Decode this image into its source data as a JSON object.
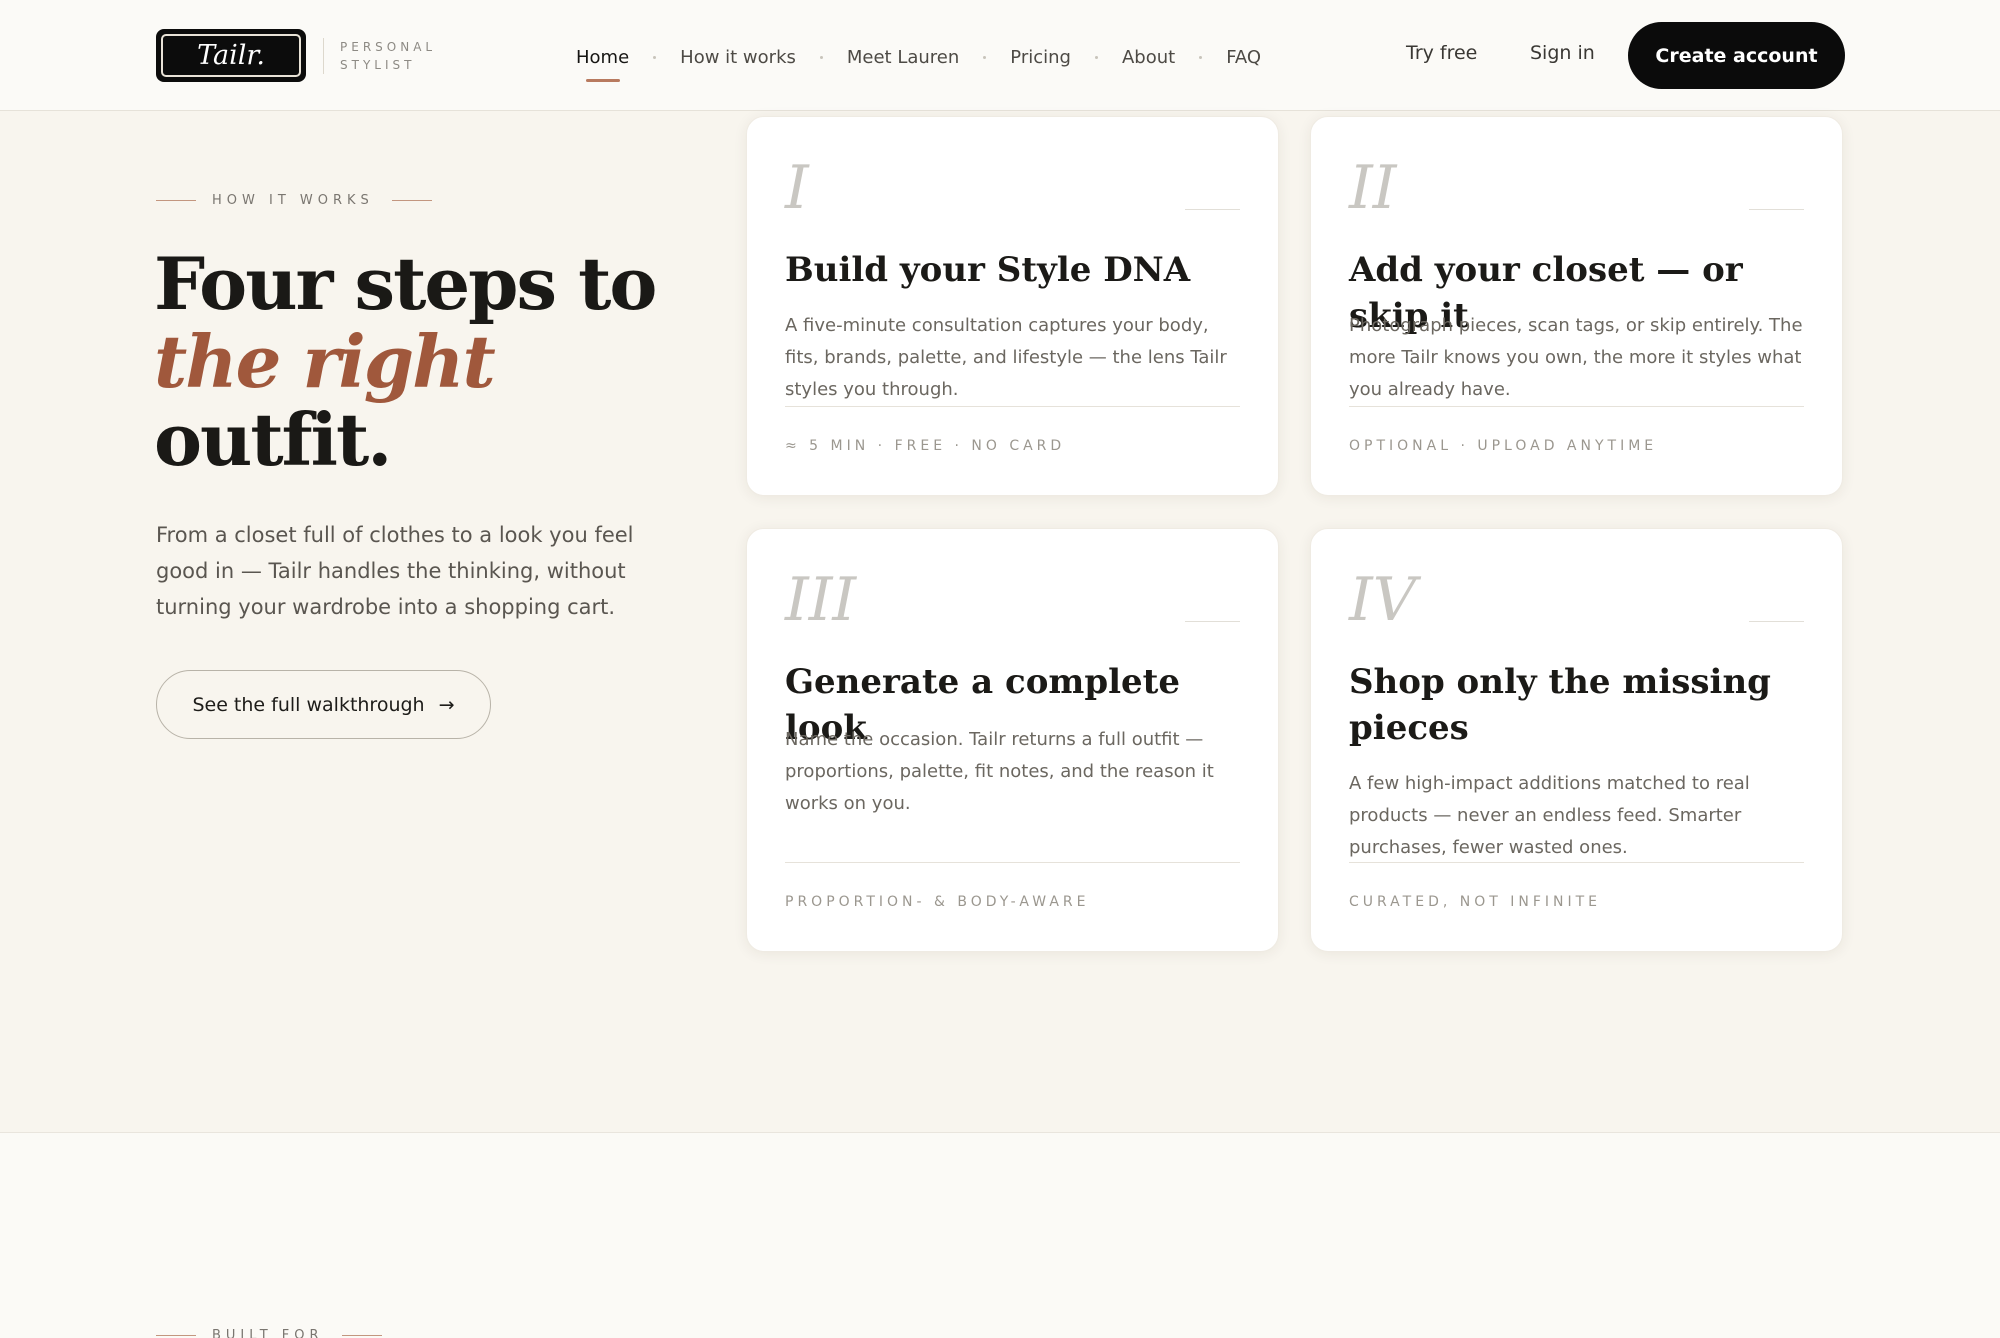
{
  "header": {
    "logo_text": "Tailr.",
    "logo_tagline": "PERSONAL STYLIST",
    "nav": [
      {
        "label": "Home",
        "active": true
      },
      {
        "label": "How it works"
      },
      {
        "label": "Meet Lauren"
      },
      {
        "label": "Pricing"
      },
      {
        "label": "About"
      },
      {
        "label": "FAQ"
      }
    ],
    "try_free": "Try free",
    "sign_in": "Sign in",
    "create_account": "Create account"
  },
  "hero": {
    "eyebrow": "HOW IT WORKS",
    "headline_line1": "Four steps to",
    "headline_accent": "the right",
    "headline_line3": "outfit.",
    "lead": "From a closet full of clothes to a look you feel good in — Tailr handles the thinking, without turning your wardrobe into a shopping cart.",
    "cta": "See the full walkthrough",
    "cta_arrow": "→"
  },
  "steps": [
    {
      "numeral": "I",
      "title": "Build your Style DNA",
      "description": "A five-minute consultation captures your body, fits, brands, palette, and lifestyle — the lens Tailr styles you through.",
      "meta": "≈ 5 MIN · FREE · NO CARD"
    },
    {
      "numeral": "II",
      "title": "Add your closet — or skip it",
      "description": "Photograph pieces, scan tags, or skip entirely. The more Tailr knows you own, the more it styles what you already have.",
      "meta": "OPTIONAL · UPLOAD ANYTIME"
    },
    {
      "numeral": "III",
      "title": "Generate a complete look",
      "description": "Name the occasion. Tailr returns a full outfit — proportions, palette, fit notes, and the reason it works on you.",
      "meta": "PROPORTION- & BODY-AWARE"
    },
    {
      "numeral": "IV",
      "title": "Shop only the missing pieces",
      "description": "A few high-impact additions matched to real products — never an endless feed. Smarter purchases, fewer wasted ones.",
      "meta": "CURATED, NOT INFINITE"
    }
  ],
  "next_section": {
    "eyebrow": "BUILT FOR"
  },
  "colors": {
    "accent": "#a0583c",
    "background": "#f8f5ee",
    "button_dark": "#0b0b0b"
  }
}
